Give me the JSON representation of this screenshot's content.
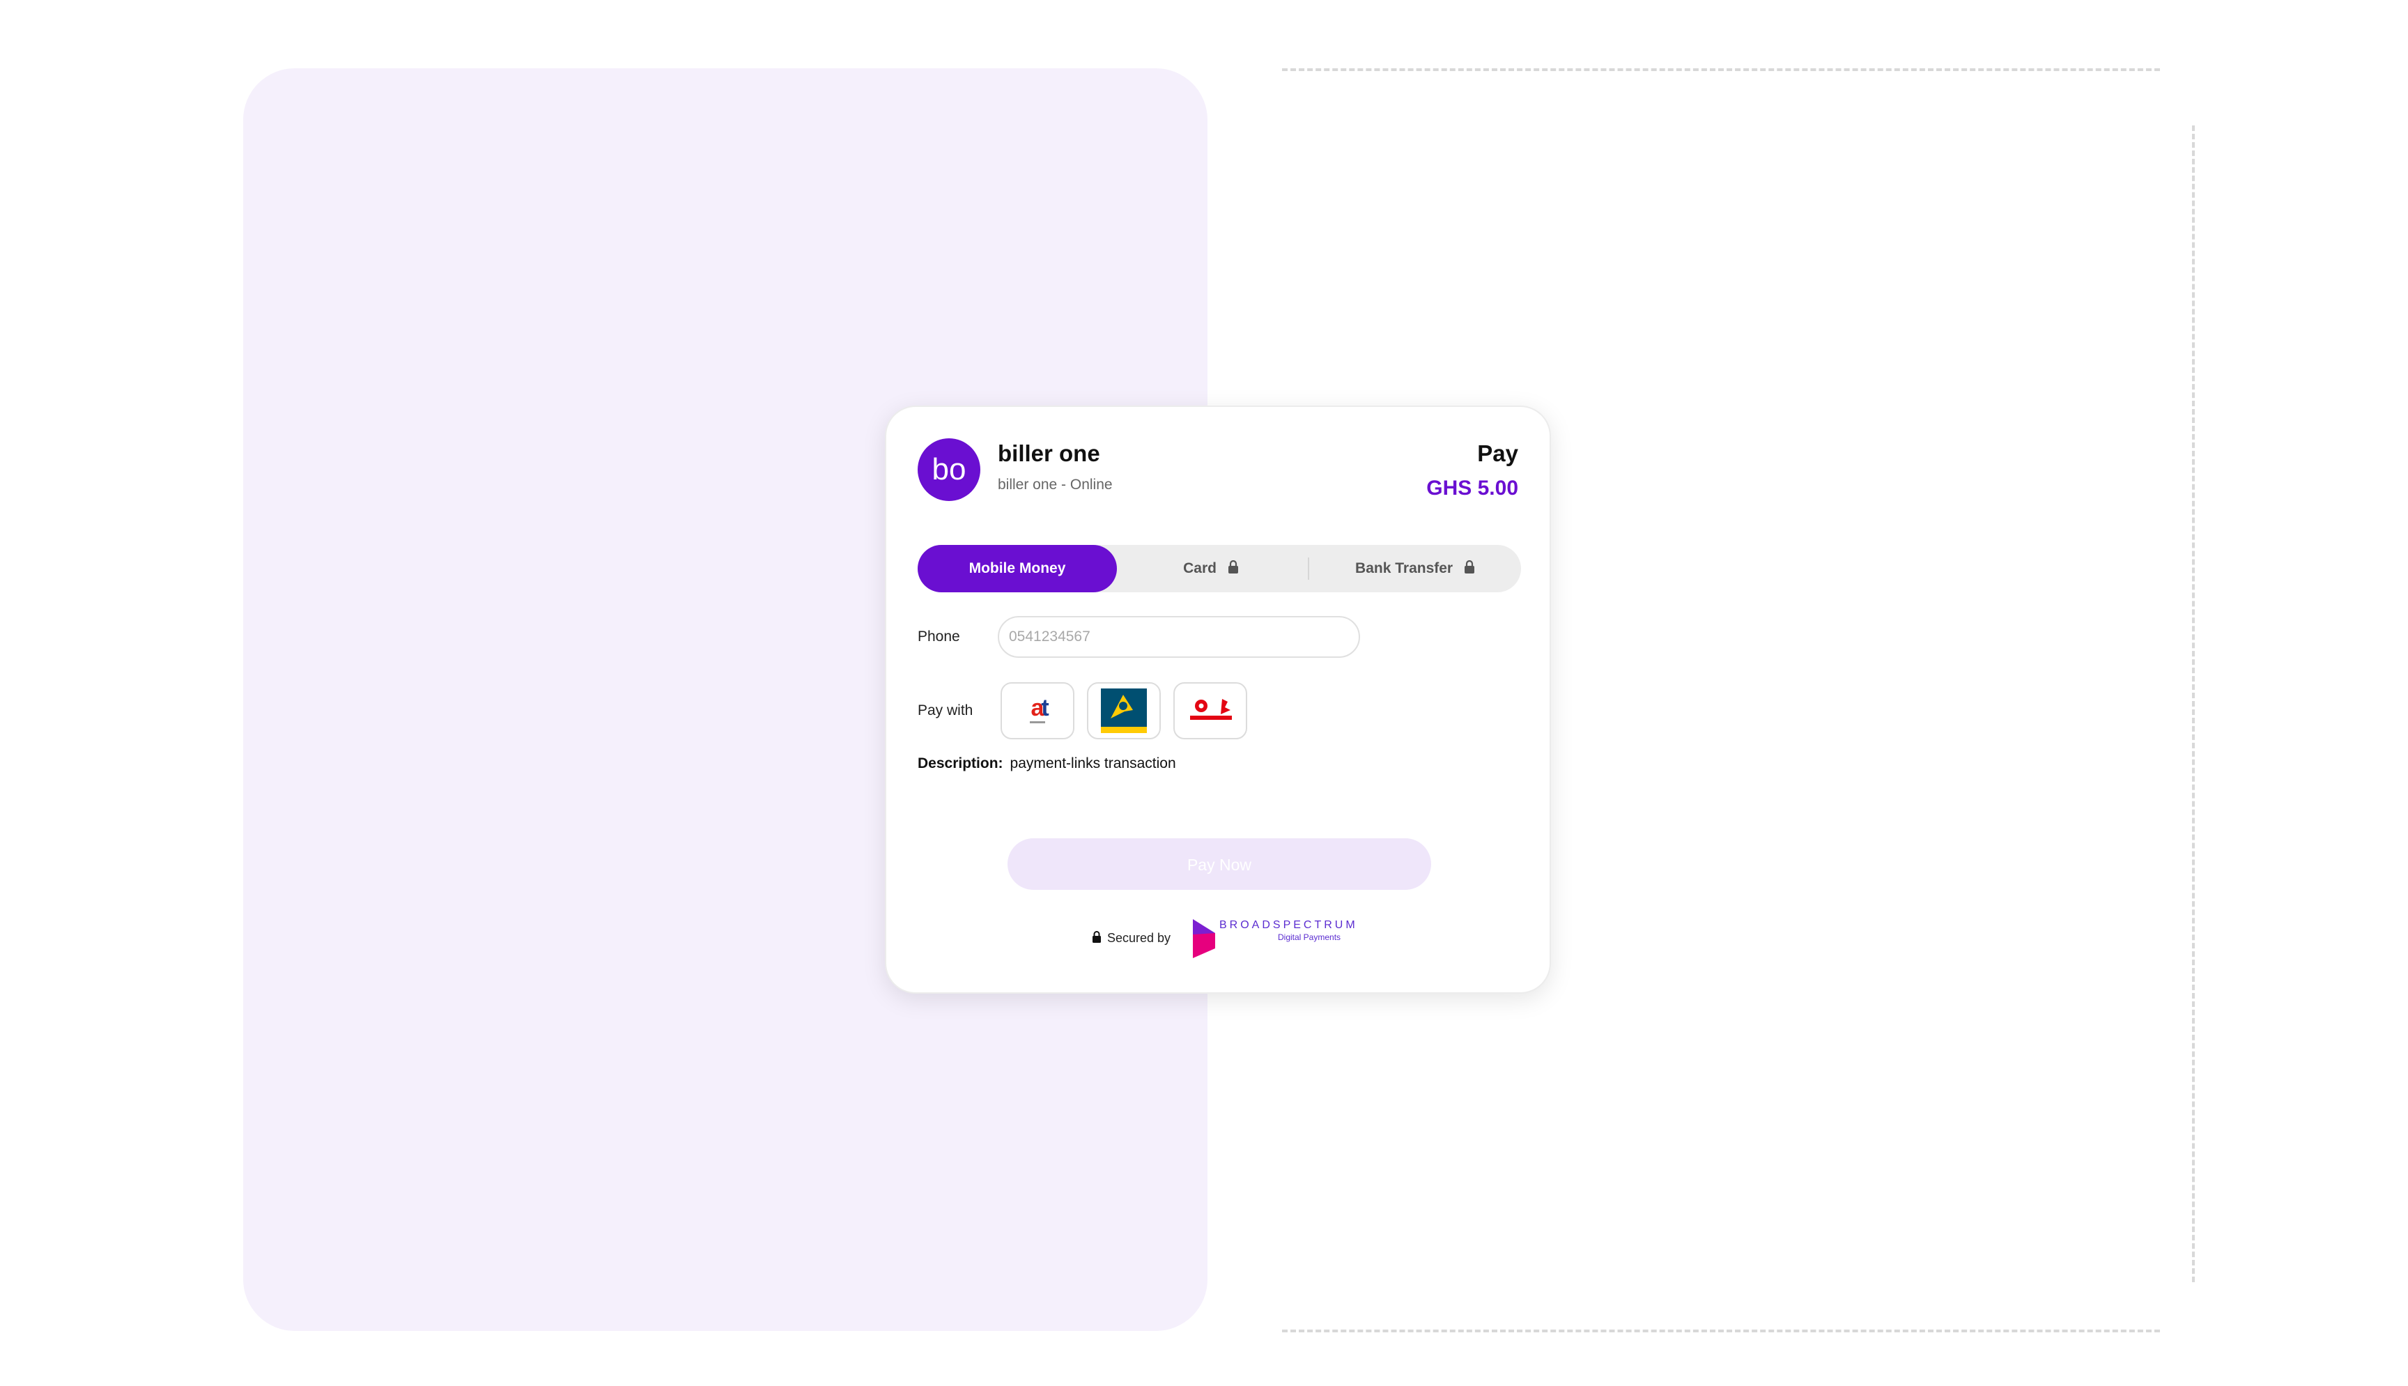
{
  "biller": {
    "avatar_initials": "bo",
    "name": "biller one",
    "subtitle": "biller one - Online"
  },
  "payment": {
    "label": "Pay",
    "amount": "GHS 5.00"
  },
  "tabs": [
    {
      "label": "Mobile Money",
      "active": true,
      "locked": false
    },
    {
      "label": "Card",
      "active": false,
      "locked": true
    },
    {
      "label": "Bank Transfer",
      "active": false,
      "locked": true
    }
  ],
  "form": {
    "phone_label": "Phone",
    "phone_placeholder": "0541234567",
    "pay_with_label": "Pay with",
    "providers": [
      "at-money-logo",
      "mtn-momo-logo",
      "telecel-cash-logo"
    ],
    "description_label": "Description:",
    "description_value": "payment-links transaction",
    "submit_label": "Pay Now"
  },
  "footer": {
    "secured_label": "Secured by",
    "brand_name": "BROADSPECTRUM",
    "brand_tagline": "Digital Payments"
  },
  "colors": {
    "brand": "#6a0fd1",
    "panel_bg": "#f5f0fc",
    "button_disabled": "#efe6fa"
  }
}
